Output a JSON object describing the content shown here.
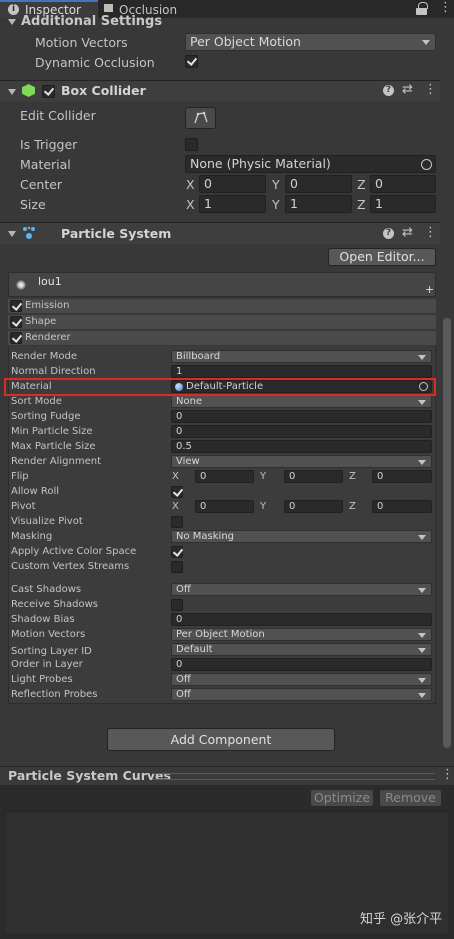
{
  "tabs": [
    {
      "label": "Inspector",
      "icon": "info-icon"
    },
    {
      "label": "Occlusion",
      "icon": "occlusion-icon"
    }
  ],
  "additional_settings": {
    "title": "Additional Settings",
    "motion_vectors_label": "Motion Vectors",
    "motion_vectors_value": "Per Object Motion",
    "dynamic_occlusion_label": "Dynamic Occlusion",
    "dynamic_occlusion_checked": true
  },
  "box_collider": {
    "title": "Box Collider",
    "enabled": true,
    "edit_collider_label": "Edit Collider",
    "is_trigger_label": "Is Trigger",
    "is_trigger_checked": false,
    "material_label": "Material",
    "material_value": "None (Physic Material)",
    "center_label": "Center",
    "center": {
      "x": "0",
      "y": "0",
      "z": "0"
    },
    "size_label": "Size",
    "size": {
      "x": "1",
      "y": "1",
      "z": "1"
    },
    "axis": {
      "x": "X",
      "y": "Y",
      "z": "Z"
    }
  },
  "particle_system": {
    "title": "Particle System",
    "open_editor": "Open Editor...",
    "name": "lou1",
    "plus": "+",
    "modules": [
      {
        "label": "Emission",
        "checked": true
      },
      {
        "label": "Shape",
        "checked": true
      },
      {
        "label": "Renderer",
        "checked": true
      }
    ]
  },
  "renderer": {
    "render_mode": {
      "label": "Render Mode",
      "value": "Billboard"
    },
    "normal_direction": {
      "label": "Normal Direction",
      "value": "1"
    },
    "material": {
      "label": "Material",
      "value": "Default-Particle"
    },
    "sort_mode": {
      "label": "Sort Mode",
      "value": "None"
    },
    "sorting_fudge": {
      "label": "Sorting Fudge",
      "value": "0"
    },
    "min_particle_size": {
      "label": "Min Particle Size",
      "value": "0"
    },
    "max_particle_size": {
      "label": "Max Particle Size",
      "value": "0.5"
    },
    "render_alignment": {
      "label": "Render Alignment",
      "value": "View"
    },
    "flip": {
      "label": "Flip",
      "x": "0",
      "y": "0",
      "z": "0"
    },
    "allow_roll": {
      "label": "Allow Roll",
      "checked": true
    },
    "pivot": {
      "label": "Pivot",
      "x": "0",
      "y": "0",
      "z": "0"
    },
    "visualize_pivot": {
      "label": "Visualize Pivot",
      "checked": false
    },
    "masking": {
      "label": "Masking",
      "value": "No Masking"
    },
    "apply_active_color_space": {
      "label": "Apply Active Color Space",
      "checked": true
    },
    "custom_vertex_streams": {
      "label": "Custom Vertex Streams",
      "checked": false
    },
    "cast_shadows": {
      "label": "Cast Shadows",
      "value": "Off"
    },
    "receive_shadows": {
      "label": "Receive Shadows",
      "checked": false
    },
    "shadow_bias": {
      "label": "Shadow Bias",
      "value": "0"
    },
    "motion_vectors": {
      "label": "Motion Vectors",
      "value": "Per Object Motion"
    },
    "sorting_layer_id": {
      "label": "Sorting Layer ID",
      "value": "Default"
    },
    "order_in_layer": {
      "label": "Order in Layer",
      "value": "0"
    },
    "light_probes": {
      "label": "Light Probes",
      "value": "Off"
    },
    "reflection_probes": {
      "label": "Reflection Probes",
      "value": "Off"
    }
  },
  "add_component": "Add Component",
  "curves": {
    "title": "Particle System Curves",
    "optimize": "Optimize",
    "remove": "Remove"
  },
  "watermark": "知乎 @张介平",
  "colors": {
    "highlight": "#e02a1f",
    "panel": "#383838",
    "field": "#2a2a2a"
  }
}
